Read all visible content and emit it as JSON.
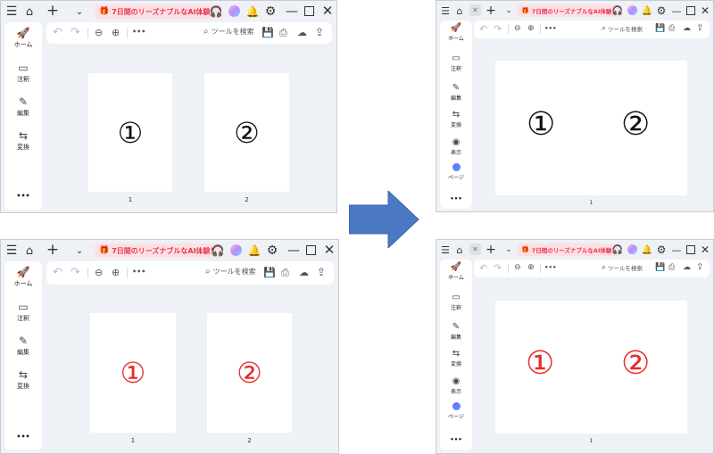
{
  "titlebar": {
    "promo_text": "7日間のリーズナブルなAI体験！",
    "icons": [
      "menu-icon",
      "home-icon",
      "close-icon",
      "plus-icon",
      "chevron-down-icon",
      "gift-icon",
      "headset-icon",
      "avatar",
      "bell-icon",
      "gear-icon",
      "minimize-icon",
      "maximize-icon",
      "close-window-icon"
    ]
  },
  "sidebar": {
    "home_label": "ホーム",
    "comment_label": "注釈",
    "edit_label": "編集",
    "convert_label": "変換",
    "view_label": "表示",
    "page_label": "ページ",
    "more_label": "•••"
  },
  "toolbar": {
    "search_placeholder": "ツールを検索",
    "more_label": "•••"
  },
  "pages": {
    "mark1": "①",
    "mark2": "②",
    "num1": "1",
    "num2": "2"
  },
  "colors": {
    "accent_red": "#e8384f",
    "mark_black": "#111111",
    "mark_red": "#e8282a",
    "arrow_blue": "#4a78c2"
  }
}
